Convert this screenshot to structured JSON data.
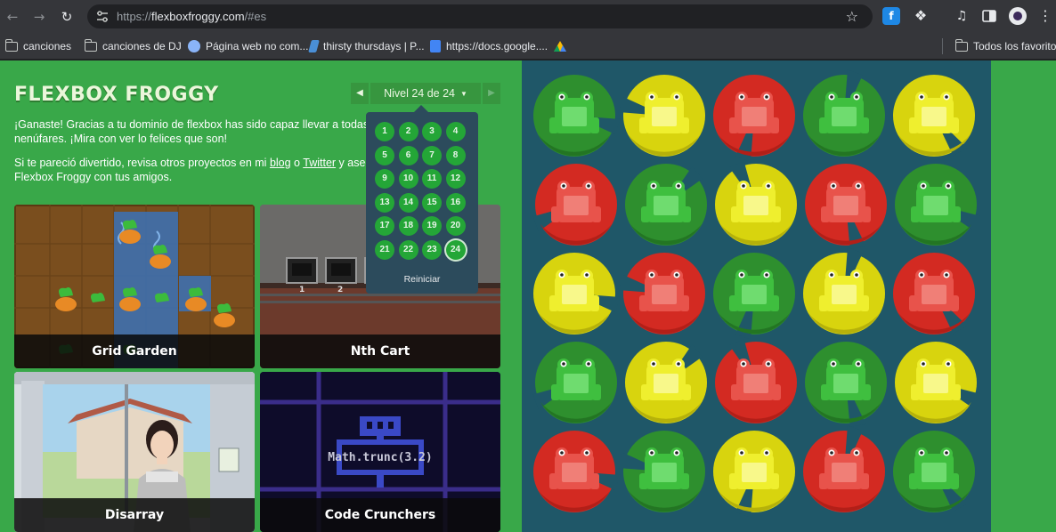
{
  "browser": {
    "url_prefix": "https://",
    "url_host": "flexboxfroggy.com",
    "url_path": "/#es",
    "bookmarks": [
      {
        "label": "canciones",
        "icon": "folder-icon"
      },
      {
        "label": "canciones de DJ",
        "icon": "folder-icon"
      },
      {
        "label": "Página web no com...",
        "icon": "globe-icon"
      },
      {
        "label": "thirsty thursdays | P...",
        "icon": "soundcloud-icon"
      },
      {
        "label": "https://docs.google....",
        "icon": "docs-icon"
      },
      {
        "label": "",
        "icon": "drive-icon"
      }
    ],
    "all_bookmarks": "Todos los favoritos"
  },
  "page": {
    "logo": "FLEXBOX FROGGY",
    "level_label": "Nivel 24 de 24",
    "paragraph1": "¡Ganaste! Gracias a tu dominio de flexbox has sido capaz llevar a todas las ranas a sus nenúfares. ¡Mira con ver lo felices que son!",
    "paragraph2_before": "Si te pareció divertido, revisa otros proyectos en mi ",
    "blog_link": "blog",
    "paragraph2_mid": " o ",
    "twitter_link": "Twitter",
    "paragraph2_after": " y asegúrate de compartir Flexbox Froggy con tus amigos.",
    "levels": [
      "1",
      "2",
      "3",
      "4",
      "5",
      "6",
      "7",
      "8",
      "9",
      "10",
      "11",
      "12",
      "13",
      "14",
      "15",
      "16",
      "17",
      "18",
      "19",
      "20",
      "21",
      "22",
      "23",
      "24"
    ],
    "current_level": "24",
    "reset_label": "Reiniciar",
    "cards": {
      "grid_garden": "Grid Garden",
      "nth_cart": "Nth Cart",
      "disarray": "Disarray",
      "code_crunchers": "Code Crunchers"
    },
    "code_crunchers_snippet": "Math.trunc(3.2)",
    "nth_cart_numbers": [
      "1",
      "2"
    ]
  },
  "colors": {
    "background_green": "#39a849",
    "pond_blue": "#1f5768",
    "red_pad": "#d32a22",
    "yellow_pad": "#d8d40e",
    "green_pad": "#2e8f2e"
  },
  "pond": {
    "rows": [
      [
        "green",
        "yellow",
        "red",
        "green",
        "yellow"
      ],
      [
        "red",
        "green",
        "yellow",
        "red",
        "green"
      ],
      [
        "yellow",
        "red",
        "green",
        "yellow",
        "red"
      ],
      [
        "green",
        "yellow",
        "red",
        "green",
        "yellow"
      ],
      [
        "red",
        "green",
        "yellow",
        "red",
        "green"
      ]
    ]
  }
}
